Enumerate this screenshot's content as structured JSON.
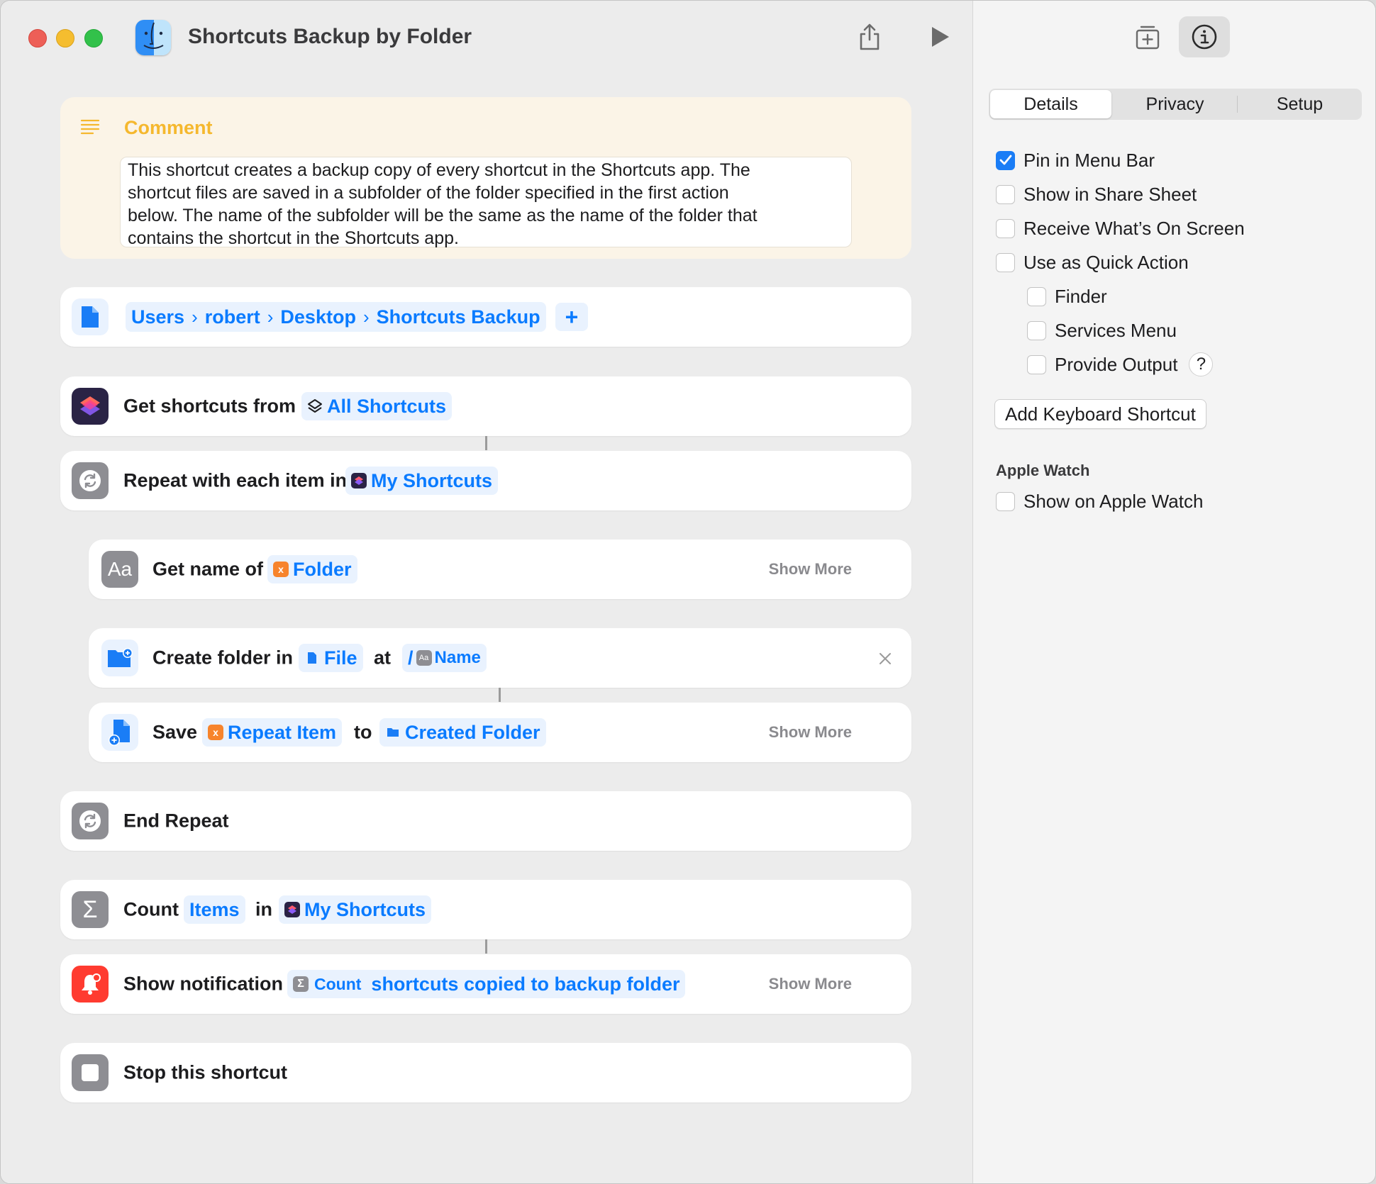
{
  "window": {
    "title": "Shortcuts Backup by Folder"
  },
  "comment": {
    "title": "Comment",
    "lines": [
      "This shortcut creates a backup copy of every shortcut in the Shortcuts app. The",
      "shortcut files are saved in a subfolder of the folder specified in the first action",
      "below. The name of the subfolder will be the same as the name of the folder that",
      "contains the shortcut in the Shortcuts app."
    ]
  },
  "path": {
    "segments": [
      "Users",
      "robert",
      "Desktop",
      "Shortcuts Backup"
    ],
    "add": "+"
  },
  "actions": {
    "get_shortcuts": {
      "label": "Get shortcuts from",
      "token": "All Shortcuts"
    },
    "repeat": {
      "label": "Repeat with each item in",
      "token": "My Shortcuts"
    },
    "get_name": {
      "label": "Get name of",
      "token": "Folder",
      "show_more": "Show More"
    },
    "create_folder": {
      "label": "Create folder in",
      "token_file": "File",
      "at": "at",
      "slash": "/",
      "token_name": "Name"
    },
    "save": {
      "label": "Save",
      "token_item": "Repeat Item",
      "to": "to",
      "token_folder": "Created Folder",
      "show_more": "Show More"
    },
    "end_repeat": {
      "label": "End Repeat"
    },
    "count": {
      "label": "Count",
      "token_items": "Items",
      "in": "in",
      "token_source": "My Shortcuts"
    },
    "notification": {
      "label": "Show notification",
      "token_count": "Count",
      "text": "shortcuts copied to backup folder",
      "show_more": "Show More"
    },
    "stop": {
      "label": "Stop this shortcut"
    }
  },
  "sidebar": {
    "tabs": [
      "Details",
      "Privacy",
      "Setup"
    ],
    "active_tab": "Details",
    "options": [
      {
        "label": "Pin in Menu Bar",
        "checked": true
      },
      {
        "label": "Show in Share Sheet",
        "checked": false
      },
      {
        "label": "Receive What’s On Screen",
        "checked": false
      },
      {
        "label": "Use as Quick Action",
        "checked": false
      },
      {
        "label": "Finder",
        "checked": false
      },
      {
        "label": "Services Menu",
        "checked": false
      },
      {
        "label": "Provide Output",
        "checked": false
      }
    ],
    "help": "?",
    "add_keyboard_shortcut": "Add Keyboard Shortcut",
    "apple_watch_heading": "Apple Watch",
    "apple_watch_option": {
      "label": "Show on Apple Watch",
      "checked": false
    }
  },
  "colors": {
    "accent": "#0a7bff",
    "comment_title": "#f5b82e",
    "comment_bg": "#fbf4e7"
  }
}
